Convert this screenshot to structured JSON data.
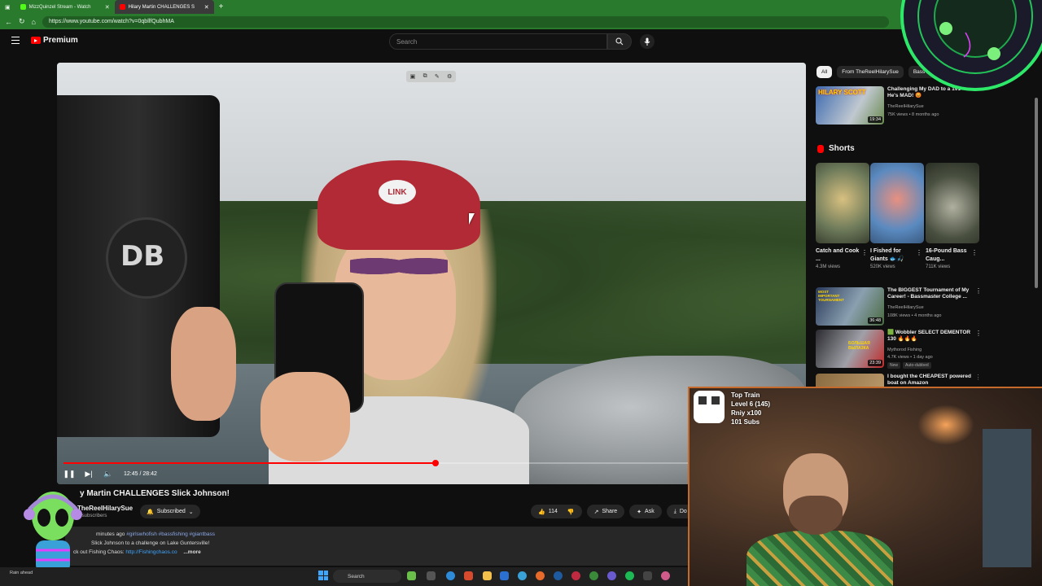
{
  "browser": {
    "tabs": [
      {
        "title": "MizzQuinzel Stream - Watch",
        "active": false,
        "color": "#9ccc65"
      },
      {
        "title": "Hilary Martin CHALLENGES S",
        "active": true,
        "color": "#ff0000"
      }
    ],
    "url": "https://www.youtube.com/watch?v=0qbllfQubhMA"
  },
  "youtube": {
    "logo": "Premium",
    "search_placeholder": "Search"
  },
  "video": {
    "cap_logo": "LINK",
    "monitor_logo": "DB",
    "time": "12:45 / 28:42",
    "progress": 0.505,
    "title": "y Martin CHALLENGES Slick Johnson!",
    "channel": "TheReelHilarySue",
    "subs": "K subscribers",
    "subscribed_label": "Subscribed",
    "likes": "114",
    "share_label": "Share",
    "ask_label": "Ask",
    "download_label": "Do",
    "desc_meta": "minutes ago",
    "desc_tags": "#girlswhofish #bassfishing #giantbass",
    "desc_line2": "Slick Johnson to a challenge on Lake Guntersville!",
    "desc_line3_prefix": "ck out Fishing Chaos:",
    "desc_link": "http://Fishingchaos.co",
    "more": "...more"
  },
  "sidebar": {
    "chips": [
      "All",
      "From TheReelHilarySue",
      "Bass fish"
    ],
    "top_rec": {
      "thumb_text": "HILARY SCOTT",
      "title": "Challenging My DAD to a 1v1 - He's MAD! 😡",
      "channel": "TheReelHilarySue",
      "meta": "75K views • 8 months ago",
      "duration": "19:34"
    },
    "shorts_title": "Shorts",
    "shorts": [
      {
        "title": "Catch and Cook ...",
        "views": "4.3M views",
        "color": "#6d7a5a"
      },
      {
        "title": "I Fished for Giants 🐟🎣",
        "views": "520K views",
        "color": "#5a8ac0"
      },
      {
        "title": "16-Pound Bass Caug...",
        "views": "711K views",
        "color": "#4a5040"
      }
    ],
    "recs": [
      {
        "thumb_text": "MOST IMPORTANT TOURNAMENT",
        "title": "The BIGGEST Tournament of My Career! - Bassmaster College ...",
        "channel": "TheReelHilarySue",
        "meta": "108K views • 4 months ago",
        "duration": "36:48",
        "badges": []
      },
      {
        "thumb_text": "БОЛЬШАЯ ВЫЛАЗКА",
        "title": "🟩 Wobbler SELECT DEMENTOR 130 🔥🔥🔥",
        "channel": "Mythorod Fishing",
        "meta": "4.7K views • 1 day ago",
        "duration": "23:39",
        "badges": [
          "New",
          "Auto-dubbed"
        ]
      },
      {
        "thumb_text": "",
        "title": "I bought the CHEAPEST powered boat on Amazon",
        "channel": "",
        "meta": "",
        "duration": "",
        "badges": []
      }
    ]
  },
  "stream": {
    "train_title": "Top Train",
    "train_level": "Level 6 (145)",
    "train_user": "Rniy x100",
    "train_subs": "101 Subs"
  },
  "taskbar": {
    "weather": "Rain ahead",
    "search": "Search"
  }
}
